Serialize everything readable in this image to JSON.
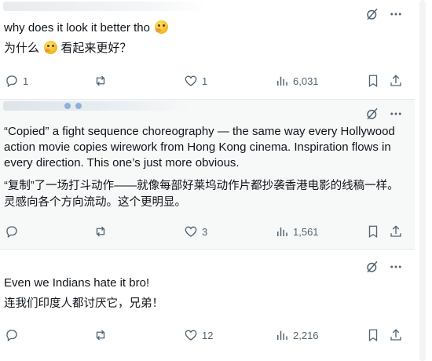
{
  "tweets": [
    {
      "text_en": "why does it look it better tho",
      "text_zh": "为什么",
      "text_zh_after": "看起来更好？",
      "replies": "1",
      "retweets": "",
      "likes": "1",
      "views": "6,031"
    },
    {
      "text_en": "“Copied” a fight sequence choreography — the same way every Hollywood action movie copies wirework from Hong Kong cinema. Inspiration flows in every direction. This one’s just more obvious.",
      "text_zh": "“复制”了一场打斗动作——就像每部好莱坞动作片都抄袭香港电影的线稿一样。灵感向各个方向流动。这个更明显。",
      "replies": "",
      "retweets": "",
      "likes": "3",
      "views": "1,561"
    },
    {
      "text_en": "Even we Indians hate it bro!",
      "text_zh": "连我们印度人都讨厌它，兄弟！",
      "replies": "",
      "retweets": "",
      "likes": "12",
      "views": "2,216"
    }
  ],
  "icons": {
    "translate": "grok-slash-icon",
    "more": "more-icon",
    "reply": "reply-icon",
    "retweet": "retweet-icon",
    "like": "like-icon",
    "views": "views-icon",
    "bookmark": "bookmark-icon",
    "share": "share-icon"
  },
  "colors": {
    "icon_gray": "#536471",
    "hover_bg": "#f7f9f9"
  }
}
